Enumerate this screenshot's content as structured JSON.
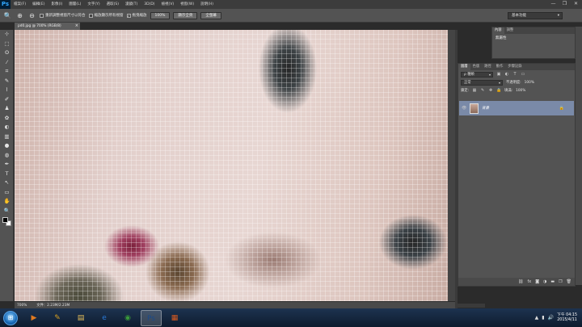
{
  "menubar": {
    "logo": "Ps",
    "items": [
      "檔案(F)",
      "編輯(E)",
      "影像(I)",
      "圖層(L)",
      "文字(Y)",
      "選取(S)",
      "濾鏡(T)",
      "3D(D)",
      "檢視(V)",
      "視窗(W)",
      "說明(H)"
    ],
    "minimize": "—",
    "maximize": "❐",
    "close": "✕"
  },
  "options": {
    "zoom_icon": "🔍",
    "zoom_in": "⊕",
    "zoom_out": "⊖",
    "resize_windows": "重新調整視窗尺寸以符合",
    "zoom_all_windows": "縮放顯示所有視窗",
    "scrubby_zoom": "拖曳縮放",
    "btn_100": "100%",
    "btn_fit_screen": "顯示全頁",
    "btn_fill_screen": "全螢幕",
    "workspace": "基本功能"
  },
  "doc": {
    "tab_title": "pd0.jpg @ 700% (RGB/8)",
    "tab_close": "×",
    "zoom": "700%",
    "file_info": "文件：2.23M/2.23M"
  },
  "tools": [
    "⊹",
    "⬚",
    "ʘ",
    "⁄",
    "⌗",
    "✎",
    "⌇",
    "✐",
    "♟",
    "✿",
    "◐",
    "▥",
    "●",
    "◍",
    "✒",
    "T",
    "↖",
    "▭",
    "✋",
    "🔍"
  ],
  "history": {
    "tabs": [
      "內容",
      "調整"
    ],
    "item": "無屬性"
  },
  "layers": {
    "tabs": [
      "圖層",
      "色版",
      "路徑",
      "動作",
      "步驟記錄"
    ],
    "kind_filter": "ρ 種類",
    "blend_mode": "正常",
    "opacity_label": "不透明度:",
    "opacity_value": "100%",
    "lock_label": "鎖定:",
    "fill_label": "填滿:",
    "fill_value": "100%",
    "layer_name": "背景"
  },
  "taskbar": {
    "apps": [
      {
        "name": "media",
        "glyph": "▶",
        "color": "#e07a20"
      },
      {
        "name": "paint",
        "glyph": "✎",
        "color": "#d8a020"
      },
      {
        "name": "explorer",
        "glyph": "▤",
        "color": "#e8c05a"
      },
      {
        "name": "ie",
        "glyph": "e",
        "color": "#2a7ad8"
      },
      {
        "name": "chrome",
        "glyph": "◉",
        "color": "#3a9a3a"
      },
      {
        "name": "photoshop",
        "glyph": "Ps",
        "color": "#1a4a8a"
      },
      {
        "name": "other",
        "glyph": "▦",
        "color": "#d85a20"
      }
    ],
    "time": "下午 04:15",
    "date": "2015/4/11"
  }
}
